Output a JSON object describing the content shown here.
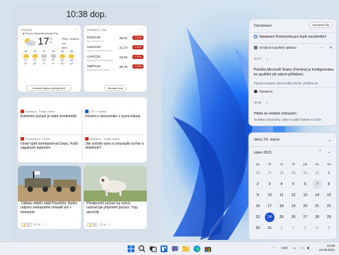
{
  "widgets": {
    "clock": "10:38 dop.",
    "weather": {
      "header": "POČASÍ",
      "location": "Orlová, Moravskoslezský Kraj",
      "temp": "17",
      "unit_c": "°C",
      "unit_f": "°F",
      "desc1": "Převl. oblačno",
      "desc2": "0%",
      "desc3": "80%",
      "days": [
        {
          "name": "Út",
          "hi": "17°",
          "lo": "9°",
          "icon": "sun-cloud-icon"
        },
        {
          "name": "St",
          "hi": "17°",
          "lo": "10°",
          "icon": "sun-icon"
        },
        {
          "name": "Čt",
          "hi": "17°",
          "lo": "9°",
          "icon": "cloud-icon"
        },
        {
          "name": "Pá",
          "hi": "17°",
          "lo": "9°",
          "icon": "cloud-icon"
        },
        {
          "name": "So",
          "hi": "20°",
          "lo": "11°",
          "icon": "sun-icon"
        },
        {
          "name": "Ne",
          "hi": "20°",
          "lo": "12°",
          "icon": "sun-icon"
        }
      ],
      "forecast_button": "Zobrazit úplnou předpověď"
    },
    "finance": {
      "header": "FINANCE | Tisk",
      "rows": [
        {
          "sym": "EUR/CZK",
          "sub": "Euro Česká koruna",
          "val": "25,51",
          "chg": "-0,16%"
        },
        {
          "sym": "USD/CZK",
          "sub": "Americký dolar Česká koruna",
          "val": "21,73",
          "chg": "-0,24%"
        },
        {
          "sym": "CHF/CZK",
          "sub": "Švýcarský frank Česká koruna",
          "val": "23,83",
          "chg": "-0,20%"
        },
        {
          "sym": "GBP/CZK",
          "sub": "Britská libra Česká koruna",
          "val": "29,79",
          "chg": "-0,19%"
        }
      ],
      "more_button": "Zobrazit více"
    },
    "news": {
      "header": "HLAVNÍ PŘÍSPĚVKY",
      "stories": [
        {
          "source": "Novinky.cz · Posled. hodina",
          "headline": "Extrémní počasí je stále smrtelnější",
          "color": "#c42b1c"
        },
        {
          "source": "ČTK · 1 hodina",
          "headline": "Důvěra v ekonomiku v srpnu klesla",
          "color": "#1a56b8"
        },
        {
          "source": "EuroZprávy.cz · 48 min",
          "headline": "Izrael opět bombardoval Gazu. Kvůli zápalným balónům",
          "color": "#c42b1c"
        },
        {
          "source": "Novinky.cz · Posled. hodina",
          "headline": "Jak vyčistit vanu a umyvadlo rychle a efektivně?",
          "color": "#c42b1c"
        }
      ]
    },
    "photos": [
      {
        "caption": "Tálibán oblékl oddíl Pandžšír. Baštu odporu nedopadne obsadit ani v minulosti",
        "meta": "Posled.",
        "likes": "256",
        "comments": "38"
      },
      {
        "caption": "Předpověď počasí na měsíc naznačuje příjemné počasí. Trpy skončily",
        "meta": "Posled.",
        "likes": "256",
        "comments": "38"
      }
    ]
  },
  "notifications": {
    "title": "Oznámení",
    "clear_all": "Vymazat vše",
    "items": [
      {
        "line": "Nastavení Pomocníka pro lepší soustředění",
        "kind": "header"
      },
      {
        "line": "Oznámení spuštění aplikace",
        "kind": "app"
      },
      {
        "time": "10:17"
      },
      {
        "line": "Položka Microsoft Teams (Preview) je konfigurována ke spuštění při vašem přihlášení.",
        "sub": "Pokud to budete chtít později změnit, přejděte do"
      },
      {
        "line": "Nastavení",
        "kind": "app"
      },
      {
        "time": "10:16"
      },
      {
        "line": "Hledá se ovladač zobrazení.",
        "sub": "Rozlišení obrazovky, výkon a výdrž baterie se může"
      }
    ]
  },
  "calendar": {
    "top": "úterý 24. srpna",
    "month": "srpen 2021",
    "weekdays": [
      "po",
      "út",
      "st",
      "čt",
      "pá",
      "so",
      "ne"
    ],
    "days": [
      {
        "d": "26",
        "dim": true
      },
      {
        "d": "27",
        "dim": true
      },
      {
        "d": "28",
        "dim": true
      },
      {
        "d": "29",
        "dim": true
      },
      {
        "d": "30",
        "dim": true
      },
      {
        "d": "31",
        "dim": true
      },
      {
        "d": "1"
      },
      {
        "d": "2"
      },
      {
        "d": "3"
      },
      {
        "d": "4"
      },
      {
        "d": "5"
      },
      {
        "d": "6"
      },
      {
        "d": "7",
        "mark": true
      },
      {
        "d": "8"
      },
      {
        "d": "9"
      },
      {
        "d": "10"
      },
      {
        "d": "11"
      },
      {
        "d": "12"
      },
      {
        "d": "13"
      },
      {
        "d": "14"
      },
      {
        "d": "15"
      },
      {
        "d": "16"
      },
      {
        "d": "17"
      },
      {
        "d": "18"
      },
      {
        "d": "19"
      },
      {
        "d": "20"
      },
      {
        "d": "21"
      },
      {
        "d": "22"
      },
      {
        "d": "23"
      },
      {
        "d": "24",
        "sel": true
      },
      {
        "d": "25"
      },
      {
        "d": "26"
      },
      {
        "d": "27"
      },
      {
        "d": "28"
      },
      {
        "d": "29"
      },
      {
        "d": "30"
      },
      {
        "d": "31"
      },
      {
        "d": "1",
        "dim": true
      },
      {
        "d": "2",
        "dim": true
      },
      {
        "d": "3",
        "dim": true
      },
      {
        "d": "4",
        "dim": true
      },
      {
        "d": "5",
        "dim": true
      }
    ]
  },
  "taskbar": {
    "lang": "CES",
    "time": "10:38",
    "date": "24.08.2021",
    "icons": [
      "windows-start-icon",
      "search-icon",
      "task-view-icon",
      "widgets-icon",
      "teams-chat-icon",
      "file-explorer-icon",
      "edge-icon",
      "store-icon"
    ]
  },
  "colors": {
    "accent": "#1f4fcf",
    "negative": "#c42b1c",
    "wallpaper": "#1e6ef5"
  }
}
